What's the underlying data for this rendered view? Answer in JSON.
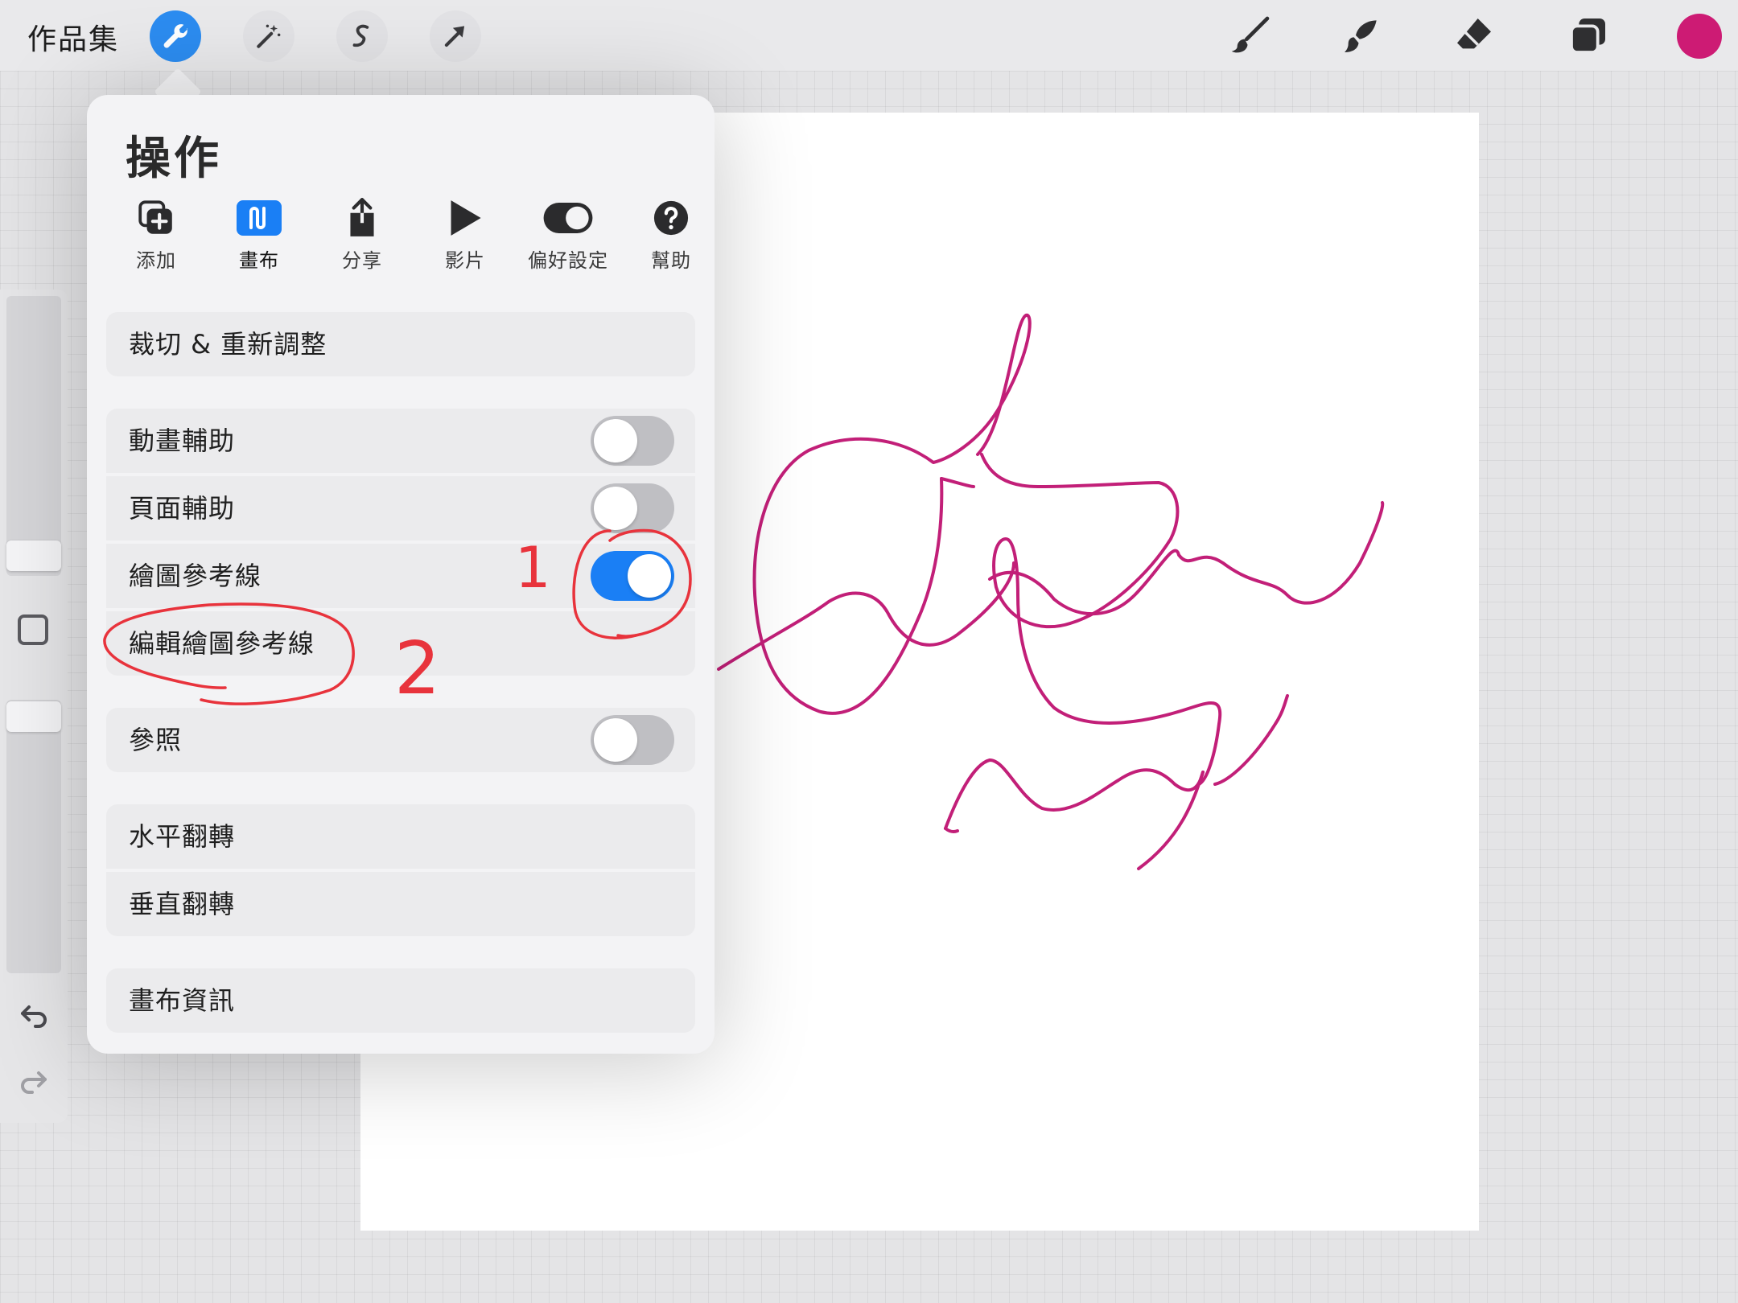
{
  "toolbar": {
    "gallery_label": "作品集",
    "left_tools": [
      "wrench-icon",
      "magic-wand-icon",
      "selection-icon",
      "transform-arrow-icon"
    ],
    "right_tools": [
      "brush-icon",
      "smudge-icon",
      "eraser-icon",
      "layers-icon"
    ],
    "current_color": "#cd1b74"
  },
  "actions_menu": {
    "title": "操作",
    "tabs": [
      {
        "label": "添加",
        "icon": "add-icon"
      },
      {
        "label": "畫布",
        "icon": "canvas-icon",
        "active": true
      },
      {
        "label": "分享",
        "icon": "share-icon"
      },
      {
        "label": "影片",
        "icon": "play-icon"
      },
      {
        "label": "偏好設定",
        "icon": "preferences-toggle-icon"
      },
      {
        "label": "幫助",
        "icon": "help-icon"
      }
    ],
    "items": {
      "crop_resize": "裁切 & 重新調整",
      "animation_assist": {
        "label": "動畫輔助",
        "on": false
      },
      "page_assist": {
        "label": "頁面輔助",
        "on": false
      },
      "drawing_guide": {
        "label": "繪圖參考線",
        "on": true
      },
      "edit_drawing_guide": "編輯繪圖參考線",
      "reference": {
        "label": "參照",
        "on": false
      },
      "flip_horizontal": "水平翻轉",
      "flip_vertical": "垂直翻轉",
      "canvas_info": "畫布資訊"
    }
  },
  "annotations": {
    "step1": "1",
    "step2": "2",
    "color": "#e8333c"
  },
  "sidebar": {
    "icons": [
      "modify-square-icon",
      "undo-icon",
      "redo-icon"
    ]
  }
}
